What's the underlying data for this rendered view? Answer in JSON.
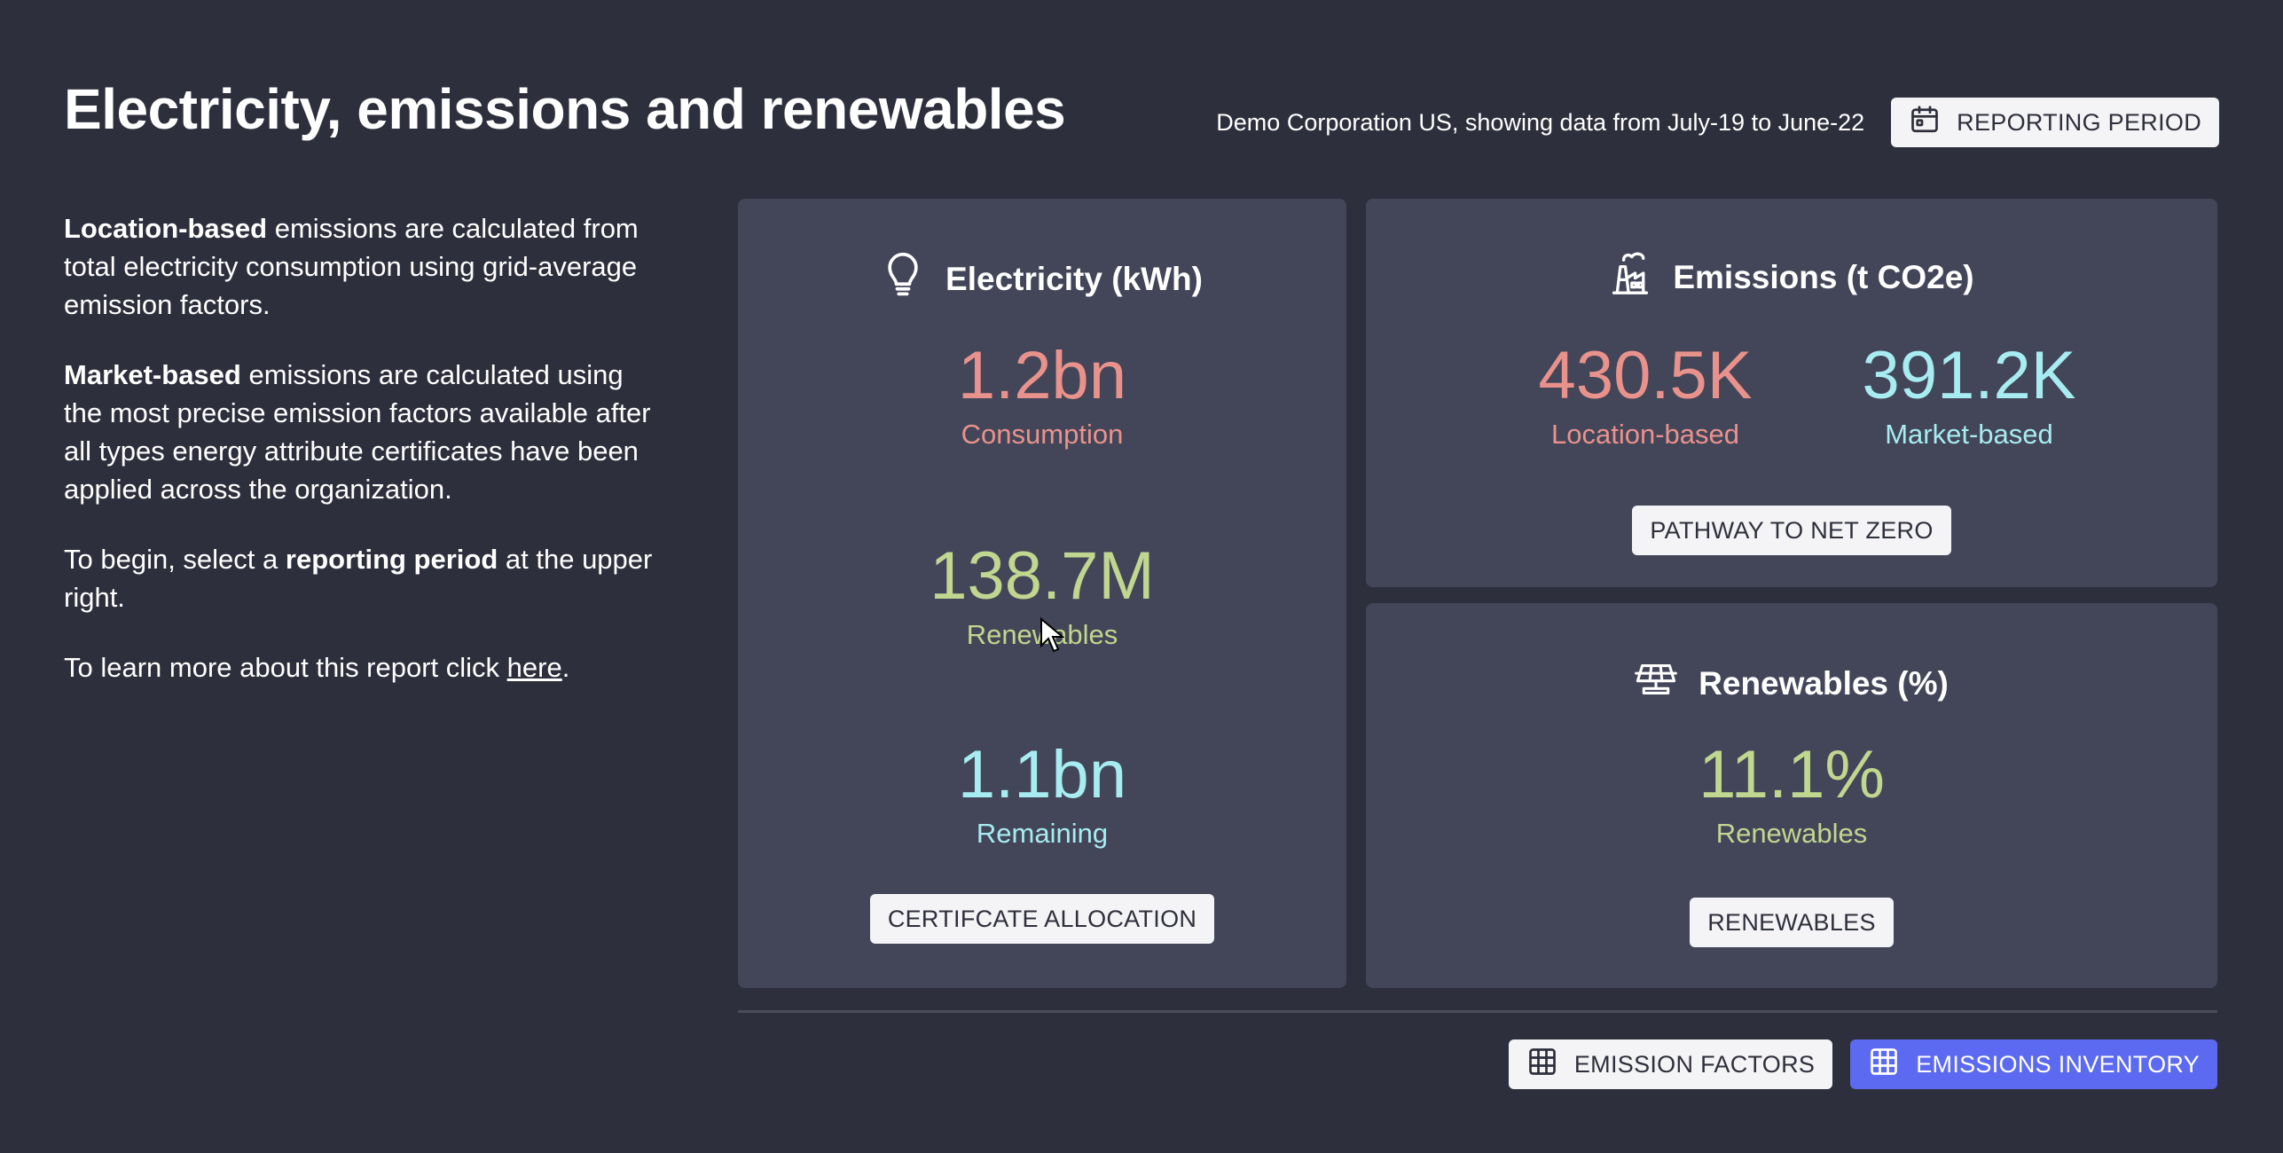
{
  "header": {
    "title": "Electricity, emissions and renewables",
    "subtitle": "Demo Corporation US, showing data from July-19 to June-22",
    "reporting_period_label": "REPORTING PERIOD"
  },
  "intro": {
    "p1_bold": "Location-based",
    "p1_text": " emissions are calculated from total electricity consumption using grid-average emission factors.",
    "p2_bold": "Market-based",
    "p2_text": " emissions are calculated using the most precise emission factors available after all types energy attribute certificates have been applied across the organization.",
    "p3_pre": "To begin, select a ",
    "p3_bold": "reporting period",
    "p3_post": " at the upper right.",
    "p4_pre": "To learn more about this report click ",
    "p4_link": "here",
    "p4_post": "."
  },
  "electricity": {
    "title": "Electricity (kWh)",
    "icon": "lightbulb-icon",
    "consumption_value": "1.2bn",
    "consumption_label": "Consumption",
    "renewables_value": "138.7M",
    "renewables_label": "Renewables",
    "remaining_value": "1.1bn",
    "remaining_label": "Remaining",
    "button_label": "CERTIFCATE ALLOCATION"
  },
  "emissions": {
    "title": "Emissions (t CO2e)",
    "icon": "factory-icon",
    "location_value": "430.5K",
    "location_label": "Location-based",
    "market_value": "391.2K",
    "market_label": "Market-based",
    "button_label": "PATHWAY TO NET ZERO"
  },
  "renewables": {
    "title": "Renewables (%)",
    "icon": "solar-panel-icon",
    "value": "11.1%",
    "label": "Renewables",
    "button_label": "RENEWABLES"
  },
  "footer": {
    "emission_factors_label": "EMISSION FACTORS",
    "emissions_inventory_label": "EMISSIONS INVENTORY"
  },
  "colors": {
    "background": "#2e2f3c",
    "card": "#434659",
    "pink": "#e9928c",
    "green": "#c1d68f",
    "cyan": "#a7ecf1",
    "primary_button": "#5b6af0"
  }
}
